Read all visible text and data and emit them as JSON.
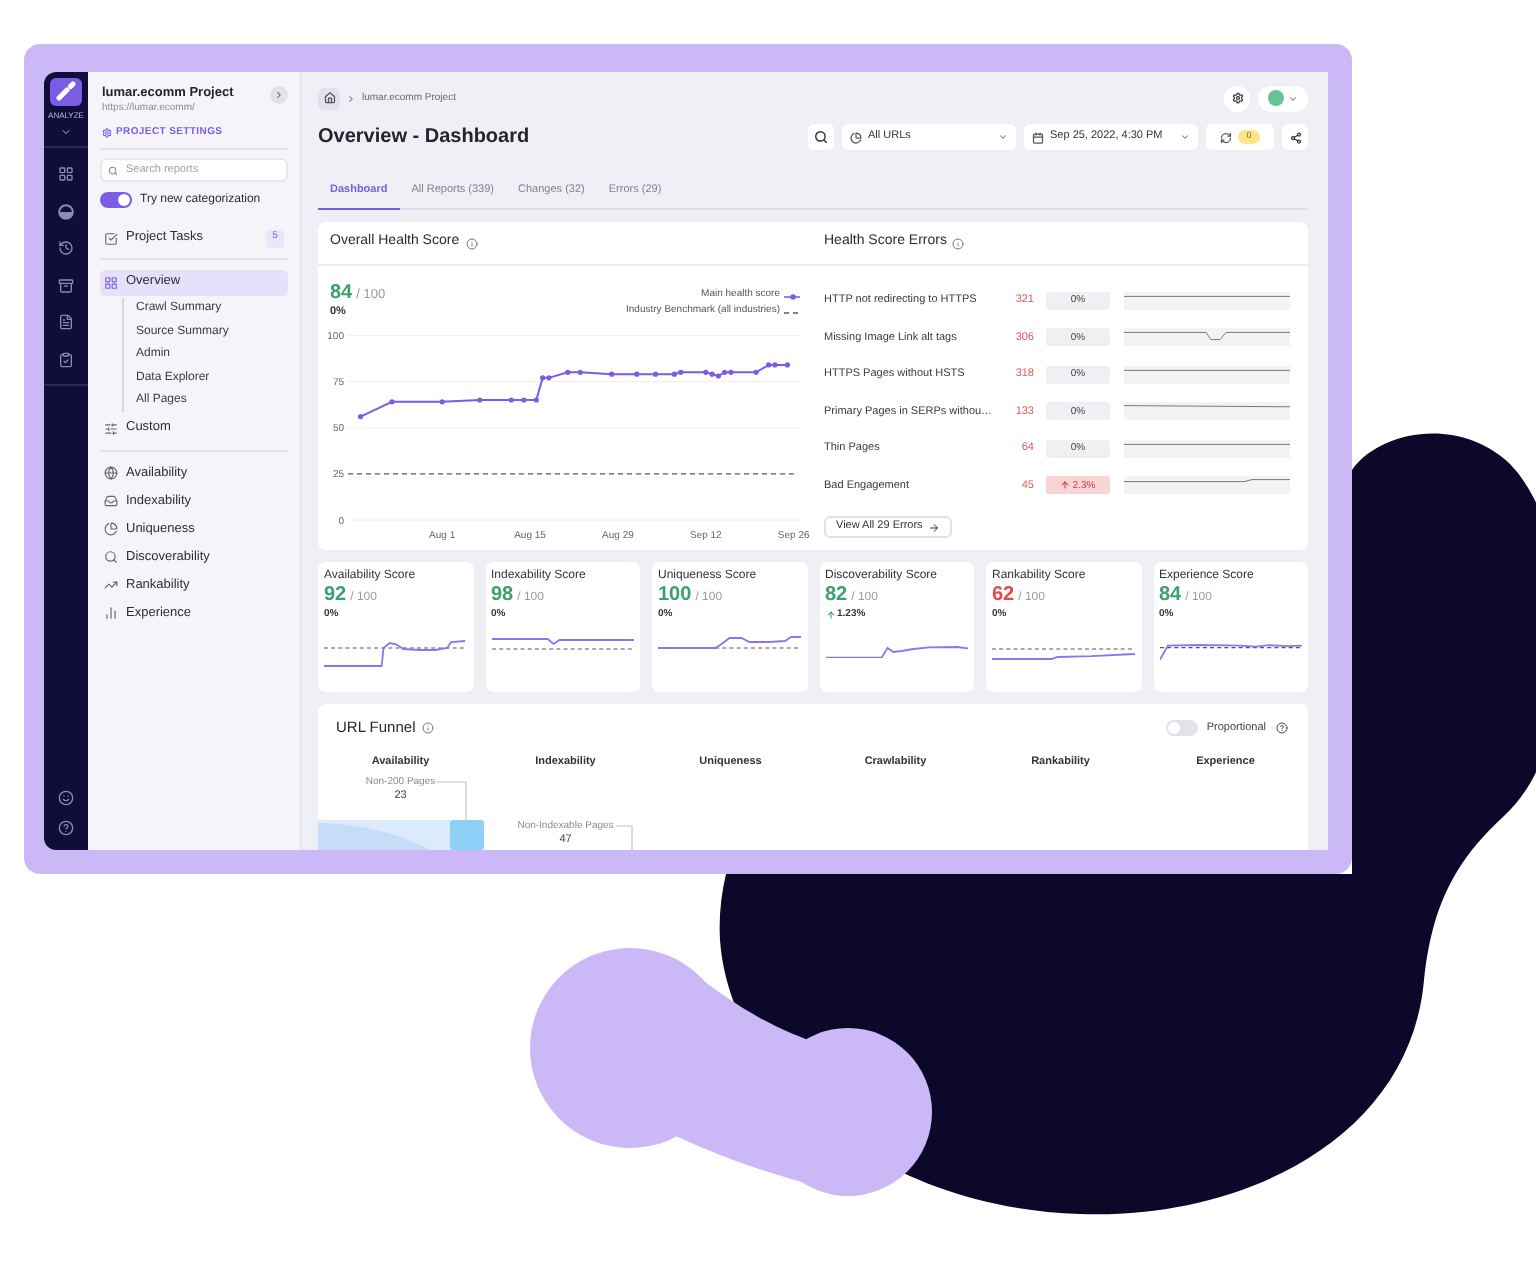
{
  "rail": {
    "label": "ANALYZE"
  },
  "sidebar": {
    "project": {
      "name": "lumar.ecomm Project",
      "url": "https://lumar.ecomm/"
    },
    "settings_link": "PROJECT SETTINGS",
    "search": {
      "placeholder": "Search reports"
    },
    "categorization_toggle": {
      "label": "Try new categorization",
      "on": true
    },
    "project_tasks": {
      "label": "Project Tasks",
      "count": "5"
    },
    "nav": [
      {
        "label": "Overview",
        "selected": true,
        "children": [
          {
            "label": "Crawl Summary",
            "selected": false
          },
          {
            "label": "Source Summary",
            "selected": false
          },
          {
            "label": "Admin",
            "selected": false
          },
          {
            "label": "Data Explorer",
            "selected": false
          },
          {
            "label": "All Pages",
            "selected": false
          }
        ]
      },
      {
        "label": "Custom",
        "selected": false
      }
    ],
    "categories": [
      {
        "label": "Availability",
        "selected": false
      },
      {
        "label": "Indexability",
        "selected": false
      },
      {
        "label": "Uniqueness",
        "selected": false
      },
      {
        "label": "Discoverability",
        "selected": false
      },
      {
        "label": "Rankability",
        "selected": false
      },
      {
        "label": "Experience",
        "selected": false
      }
    ]
  },
  "breadcrumb": [
    "lumar.ecomm Project"
  ],
  "page_title": "Overview - Dashboard",
  "toolbar": {
    "url_filter": "All URLs",
    "date": "Sep 25, 2022, 4:30 PM",
    "refresh_count": "0"
  },
  "tabs": [
    {
      "label": "Dashboard",
      "selected": true
    },
    {
      "label": "All Reports",
      "count": "(339)",
      "selected": false
    },
    {
      "label": "Changes",
      "count": "(32)",
      "selected": false
    },
    {
      "label": "Errors",
      "count": "(29)",
      "selected": false
    }
  ],
  "health_score": {
    "title": "Overall Health Score",
    "score": "84",
    "out_of": "/ 100",
    "change": "0%",
    "chart_data": {
      "type": "line",
      "grid": true,
      "categories": [
        null,
        null,
        null,
        null,
        null,
        null,
        null,
        null,
        null,
        null,
        null,
        null,
        null,
        null,
        null,
        "Aug 1",
        null,
        null,
        null,
        null,
        null,
        null,
        null,
        null,
        null,
        null,
        null,
        null,
        null,
        "Aug 15",
        null,
        null,
        null,
        null,
        null,
        null,
        null,
        null,
        null,
        null,
        null,
        null,
        null,
        "Aug 29",
        null,
        null,
        null,
        null,
        null,
        null,
        null,
        null,
        null,
        null,
        null,
        null,
        null,
        "Sep 12",
        null,
        null,
        null,
        null,
        null,
        null,
        null,
        null,
        null,
        null,
        null,
        null,
        null,
        "Sep 26"
      ],
      "series": [
        {
          "name": "Main health score",
          "color": "#7b5ce5",
          "line_style": "solid",
          "values": [
            null,
            null,
            56,
            null,
            null,
            null,
            null,
            64,
            null,
            null,
            null,
            null,
            null,
            null,
            null,
            64,
            null,
            null,
            null,
            null,
            null,
            65,
            null,
            null,
            null,
            null,
            65,
            null,
            65,
            null,
            65,
            77,
            77,
            null,
            null,
            80,
            null,
            80,
            null,
            null,
            null,
            null,
            79,
            null,
            null,
            null,
            79,
            null,
            null,
            79,
            null,
            null,
            79,
            80,
            null,
            null,
            null,
            80,
            79,
            78,
            80,
            80,
            null,
            null,
            null,
            80,
            null,
            84,
            84,
            null,
            84,
            null
          ]
        },
        {
          "name": "Industry Benchmark (all industries)",
          "color": "#5c5c66",
          "line_style": "dashed",
          "values": [
            25,
            25,
            25,
            25,
            25,
            25,
            25,
            25,
            25,
            25,
            25,
            25,
            25,
            25,
            25,
            25,
            25,
            25,
            25,
            25,
            25,
            25,
            25,
            25,
            25,
            25,
            25,
            25,
            25,
            25,
            25,
            25,
            25,
            25,
            25,
            25,
            25,
            25,
            25,
            25,
            25,
            25,
            25,
            25,
            25,
            25,
            25,
            25,
            25,
            25,
            25,
            25,
            25,
            25,
            25,
            25,
            25,
            25,
            25,
            25,
            25,
            25,
            25,
            25,
            25,
            25,
            25,
            25,
            25,
            25,
            25,
            25
          ]
        }
      ],
      "ylim": [
        0,
        100
      ],
      "yticks": [
        0,
        25,
        50,
        75,
        100
      ]
    }
  },
  "health_score_errors": {
    "title": "Health Score Errors",
    "rows": [
      {
        "label": "HTTP not redirecting to HTTPS",
        "count": "321",
        "change": "0%",
        "kind": "neutral"
      },
      {
        "label": "Missing Image Link alt tags",
        "count": "306",
        "change": "0%",
        "kind": "neutral"
      },
      {
        "label": "HTTPS Pages without HSTS",
        "count": "318",
        "change": "0%",
        "kind": "neutral"
      },
      {
        "label": "Primary Pages in SERPs withou…",
        "count": "133",
        "change": "0%",
        "kind": "neutral"
      },
      {
        "label": "Thin Pages",
        "count": "64",
        "change": "0%",
        "kind": "neutral"
      },
      {
        "label": "Bad Engagement",
        "count": "45",
        "change": "2.3%",
        "kind": "increase"
      }
    ],
    "view_all": "View All 29 Errors"
  },
  "score_cards": [
    {
      "title": "Availability Score",
      "score": "92",
      "out_of": "/ 100",
      "change": "0%",
      "kind": "neutral",
      "color": "#3e9f6f"
    },
    {
      "title": "Indexability Score",
      "score": "98",
      "out_of": "/ 100",
      "change": "0%",
      "kind": "neutral",
      "color": "#3e9f6f"
    },
    {
      "title": "Uniqueness Score",
      "score": "100",
      "out_of": "/ 100",
      "change": "0%",
      "kind": "neutral",
      "color": "#3e9f6f"
    },
    {
      "title": "Discoverability Score",
      "score": "82",
      "out_of": "/ 100",
      "change": "1.23%",
      "kind": "increase",
      "color": "#3e9f6f"
    },
    {
      "title": "Rankability Score",
      "score": "62",
      "out_of": "/ 100",
      "change": "0%",
      "kind": "neutral",
      "color": "#e5484d"
    },
    {
      "title": "Experience Score",
      "score": "84",
      "out_of": "/ 100",
      "change": "0%",
      "kind": "neutral",
      "color": "#3e9f6f"
    }
  ],
  "url_funnel": {
    "title": "URL Funnel",
    "proportional": {
      "label": "Proportional",
      "on": false
    },
    "columns": [
      {
        "label": "Availability",
        "annotation": {
          "label": "Non-200 Pages",
          "value": "23"
        }
      },
      {
        "label": "Indexability",
        "annotation": {
          "label": "Non-Indexable Pages",
          "value": "47"
        }
      },
      {
        "label": "Uniqueness"
      },
      {
        "label": "Crawlability"
      },
      {
        "label": "Rankability"
      },
      {
        "label": "Experience"
      }
    ]
  }
}
